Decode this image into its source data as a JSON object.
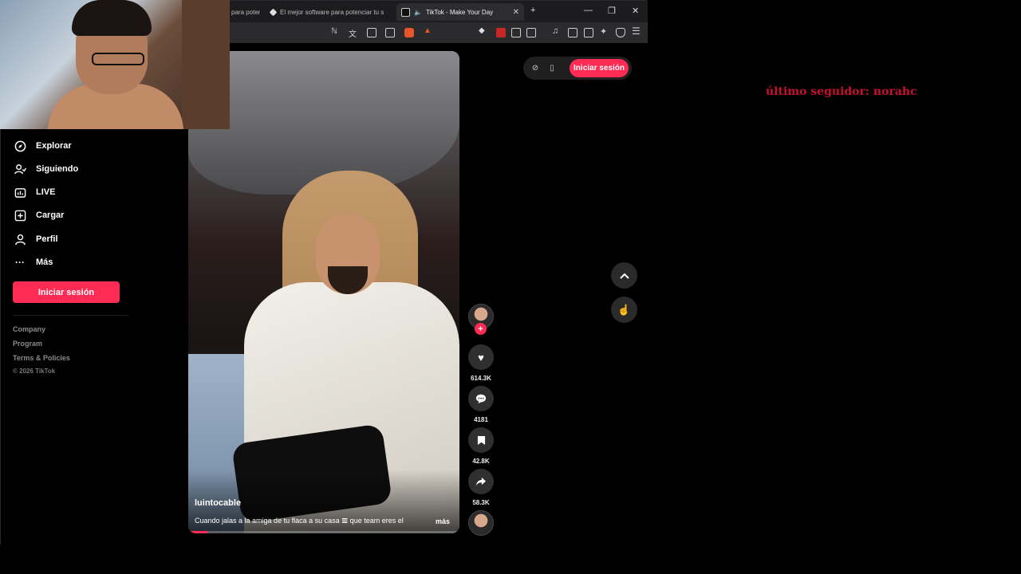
{
  "tabs": [
    {
      "label": "para potenciar tu s",
      "active": false
    },
    {
      "label": "El mejor software para potenciar tu s",
      "active": false
    },
    {
      "label": "TikTok - Make Your Day",
      "active": true
    }
  ],
  "sidebar": {
    "items": [
      {
        "label": "Explorar",
        "icon": "compass-icon"
      },
      {
        "label": "Siguiendo",
        "icon": "following-icon"
      },
      {
        "label": "LIVE",
        "icon": "live-icon"
      },
      {
        "label": "Cargar",
        "icon": "upload-icon"
      },
      {
        "label": "Perfil",
        "icon": "profile-icon"
      },
      {
        "label": "Más",
        "icon": "more-icon"
      }
    ],
    "login_label": "Iniciar sesión",
    "footer_links": [
      "Company",
      "Program",
      "Terms & Policies"
    ],
    "copyright": "© 2026 TikTok"
  },
  "video": {
    "author": "luintocable",
    "caption": "Cuando jalas a la amiga de tu flaca a su casa 𝌆 que team eres el",
    "more_label": "más",
    "progress_fraction": 0.07
  },
  "actions": {
    "likes": "614.3K",
    "comments": "4181",
    "saves": "42.8K",
    "shares": "58.3K"
  },
  "header": {
    "login_label": "Iniciar sesión"
  },
  "overlay": {
    "text": "último seguidor: norahc"
  },
  "colors": {
    "accent": "#fe2c55",
    "overlay_text": "#c8102e"
  }
}
